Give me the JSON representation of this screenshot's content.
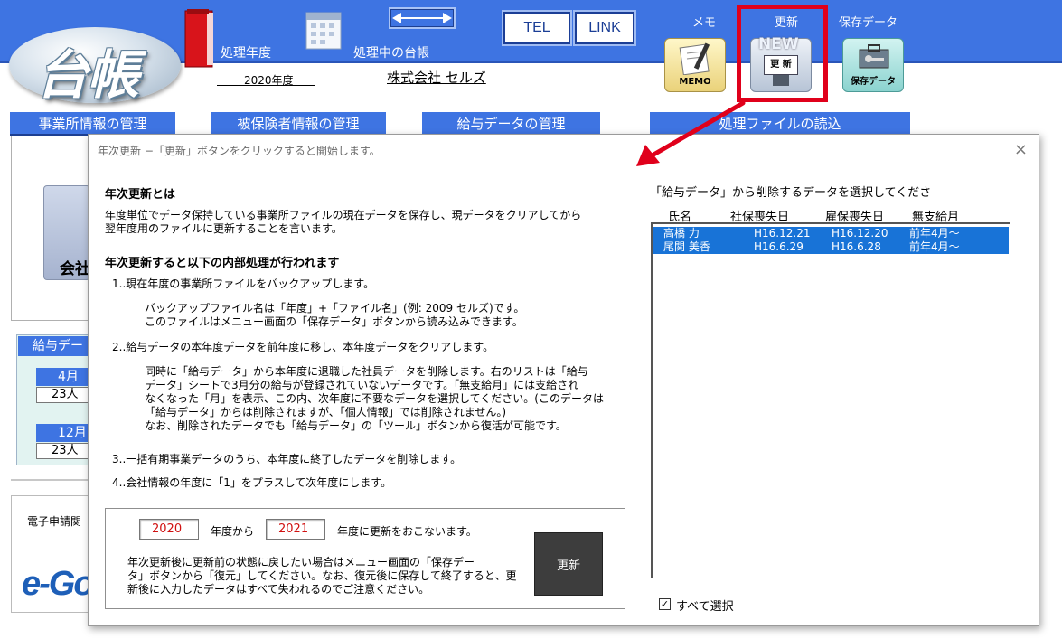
{
  "header": {
    "logo_text": "台帳",
    "fiscal_year_label": "処理年度",
    "fiscal_year_value": "2020年度",
    "ledger_label": "処理中の台帳",
    "company_name": "株式会社 セルズ",
    "tel_button": "TEL",
    "link_button": "LINK",
    "memo_label": "メモ",
    "update_label": "更新",
    "saved_data_label": "保存データ",
    "memo_icon_text": "MEMO",
    "update_icon_badge": "NEW",
    "update_icon_text": "更 新",
    "saved_icon_text": "保存データ",
    "accent_color": "#3e74e2",
    "highlight_color": "#e0001b"
  },
  "tabs": [
    {
      "label": "事業所情報の管理"
    },
    {
      "label": "被保険者情報の管理"
    },
    {
      "label": "給与データの管理"
    },
    {
      "label": "処理ファイルの読込"
    }
  ],
  "left_panel": {
    "company_partial": "会社",
    "salary_head_partial": "給与デー",
    "month1": "4月",
    "count1": "23人",
    "month2": "12月",
    "count2": "23人",
    "egov_title_partial": "電子申請関",
    "egov_logo_partial": "e-Gov"
  },
  "dialog": {
    "title": "年次更新 −「更新」ボタンをクリックすると開始します。",
    "close_icon": "×",
    "section1_head": "年次更新とは",
    "section1_body": "年度単位でデータ保持している事業所ファイルの現在データを保存し、現データをクリアしてから\n翌年度用のファイルに更新することを言います。",
    "section2_head": "年次更新すると以下の内部処理が行われます",
    "step1": "1..現在年度の事業所ファイルをバックアップします。",
    "step1_detail": "バックアップファイル名は「年度」+「ファイル名」(例: 2009 セルズ)です。\nこのファイルはメニュー画面の「保存データ」ボタンから読み込みできます。",
    "step2": "2..給与データの本年度データを前年度に移し、本年度データをクリアします。",
    "step2_detail": "同時に「給与データ」から本年度に退職した社員データを削除します。右のリストは「給与\nデータ」シートで3月分の給与が登録されていないデータです。「無支給月」には支給され\nなくなった「月」を表示、この内、次年度に不要なデータを選択してください。(このデータは\n「給与データ」からは削除されますが、「個人情報」では削除されません。)\nなお、削除されたデータでも「給与データ」の「ツール」ボタンから復活が可能です。",
    "step3": "3..一括有期事業データのうち、本年度に終了したデータを削除します。",
    "step4": "4..会社情報の年度に「1」をプラスして次年度にします。",
    "from_year": "2020",
    "from_suffix": "年度から",
    "to_year": "2021",
    "to_suffix": "年度に更新をおこないます。",
    "restore_note": "年次更新後に更新前の状態に戻したい場合はメニュー画面の「保存デー\nタ」ボタンから「復元」してください。なお、復元後に保存して終了すると、更\n新後に入力したデータはすべて失われるのでご注意ください。",
    "update_button": "更新",
    "list_caption": "「給与データ」から削除するデータを選択してくださ",
    "list_headers": [
      "氏名",
      "社保喪失日",
      "雇保喪失日",
      "無支給月"
    ],
    "list_rows": [
      {
        "name": "高橋 力",
        "shaho": "H16.12.21",
        "koho": "H16.12.20",
        "month": "前年4月〜"
      },
      {
        "name": "尾関 美香",
        "shaho": "H16.6.29",
        "koho": "H16.6.28",
        "month": "前年4月〜"
      }
    ],
    "select_all_label": "すべて選択",
    "select_all_checked": "✓"
  }
}
